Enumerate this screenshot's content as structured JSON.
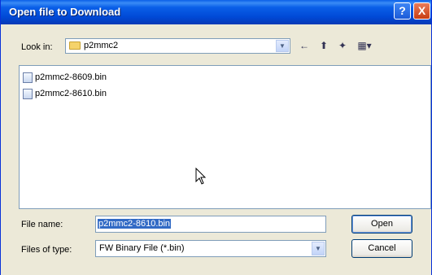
{
  "window": {
    "title": "Open file to Download",
    "help_label": "?",
    "close_label": "X"
  },
  "lookin": {
    "label": "Look in:",
    "value": "p2mmc2"
  },
  "toolbar": {
    "back": "←",
    "up": "⬆",
    "newfolder": "✦",
    "views": "▦▾"
  },
  "files": [
    "p2mmc2-8609.bin",
    "p2mmc2-8610.bin"
  ],
  "filename": {
    "label": "File name:",
    "value": "p2mmc2-8610.bin"
  },
  "filetype": {
    "label": "Files of type:",
    "value": "FW Binary File (*.bin)"
  },
  "buttons": {
    "open": "Open",
    "cancel": "Cancel"
  },
  "icons": {
    "folder": "folder-icon",
    "file": "file-icon",
    "cursor": "mouse-cursor-icon"
  }
}
